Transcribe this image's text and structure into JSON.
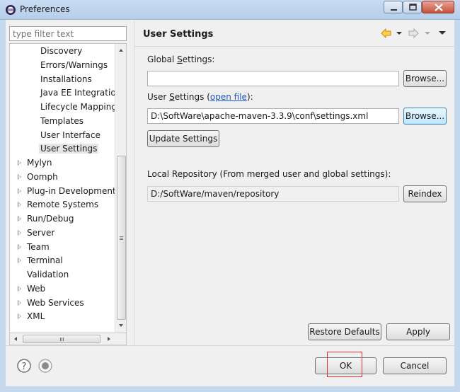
{
  "window": {
    "title": "Preferences"
  },
  "filter": {
    "placeholder": "type filter text"
  },
  "tree": {
    "items": [
      {
        "label": "Discovery",
        "expandable": false,
        "selected": false
      },
      {
        "label": "Errors/Warnings",
        "expandable": false,
        "selected": false
      },
      {
        "label": "Installations",
        "expandable": false,
        "selected": false
      },
      {
        "label": "Java EE Integration",
        "expandable": false,
        "selected": false
      },
      {
        "label": "Lifecycle Mapping",
        "expandable": false,
        "selected": false
      },
      {
        "label": "Templates",
        "expandable": false,
        "selected": false
      },
      {
        "label": "User Interface",
        "expandable": false,
        "selected": false
      },
      {
        "label": "User Settings",
        "expandable": false,
        "selected": true
      },
      {
        "label": "Mylyn",
        "expandable": true,
        "selected": false
      },
      {
        "label": "Oomph",
        "expandable": true,
        "selected": false
      },
      {
        "label": "Plug-in Development",
        "expandable": true,
        "selected": false
      },
      {
        "label": "Remote Systems",
        "expandable": true,
        "selected": false
      },
      {
        "label": "Run/Debug",
        "expandable": true,
        "selected": false
      },
      {
        "label": "Server",
        "expandable": true,
        "selected": false
      },
      {
        "label": "Team",
        "expandable": true,
        "selected": false
      },
      {
        "label": "Terminal",
        "expandable": true,
        "selected": false
      },
      {
        "label": "Validation",
        "expandable": false,
        "selected": false
      },
      {
        "label": "Web",
        "expandable": true,
        "selected": false
      },
      {
        "label": "Web Services",
        "expandable": true,
        "selected": false
      },
      {
        "label": "XML",
        "expandable": true,
        "selected": false
      }
    ]
  },
  "page": {
    "title": "User Settings",
    "global_label_pre": "Global ",
    "global_label_key": "S",
    "global_label_post": "ettings:",
    "global_value": "",
    "user_label_pre": "User ",
    "user_label_key": "S",
    "user_label_post": "ettings (",
    "user_link": "open file",
    "user_label_end": "):",
    "user_value": "D:\\SoftWare\\apache-maven-3.3.9\\conf\\settings.xml",
    "browse_label": "Browse...",
    "update_label": "Update Settings",
    "local_label": "Local Repository (From merged user and global settings):",
    "local_value": "D:/SoftWare/maven/repository",
    "reindex_label": "Reindex",
    "restore_label": "Restore Defaults",
    "apply_label": "Apply"
  },
  "dialog": {
    "ok_label": "OK",
    "cancel_label": "Cancel"
  },
  "colors": {
    "link": "#1f55c9",
    "highlight": "#e03030",
    "nav_arrow": "#e8a000"
  }
}
